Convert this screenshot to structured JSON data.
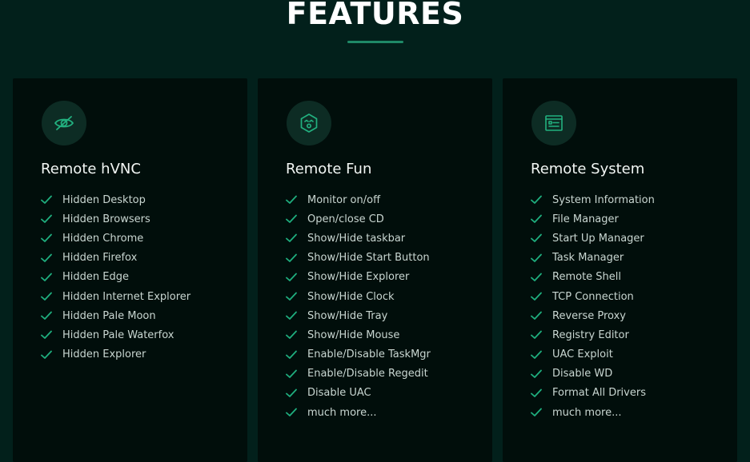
{
  "header": {
    "title": "FEATURES"
  },
  "colors": {
    "background": "#02201b",
    "card": "#010e0b",
    "accent": "#1f8a68",
    "check": "#1fae7e"
  },
  "cards": [
    {
      "icon": "eye-slash-icon",
      "title": "Remote hVNC",
      "items": [
        "Hidden Desktop",
        "Hidden Browsers",
        "Hidden Chrome",
        "Hidden Firefox",
        "Hidden Edge",
        "Hidden Internet Explorer",
        "Hidden Pale Moon",
        "Hidden Pale Waterfox",
        "Hidden Explorer"
      ]
    },
    {
      "icon": "fun-face-icon",
      "title": "Remote Fun",
      "items": [
        "Monitor on/off",
        "Open/close CD",
        "Show/Hide taskbar",
        "Show/Hide Start Button",
        "Show/Hide Explorer",
        "Show/Hide Clock",
        "Show/Hide Tray",
        "Show/Hide Mouse",
        "Enable/Disable TaskMgr",
        "Enable/Disable Regedit",
        "Disable UAC",
        "much more..."
      ]
    },
    {
      "icon": "system-window-icon",
      "title": "Remote System",
      "items": [
        "System Information",
        "File Manager",
        "Start Up Manager",
        "Task Manager",
        "Remote Shell",
        "TCP Connection",
        "Reverse Proxy",
        "Registry Editor",
        "UAC Exploit",
        "Disable WD",
        "Format All Drivers",
        "much more..."
      ]
    }
  ]
}
